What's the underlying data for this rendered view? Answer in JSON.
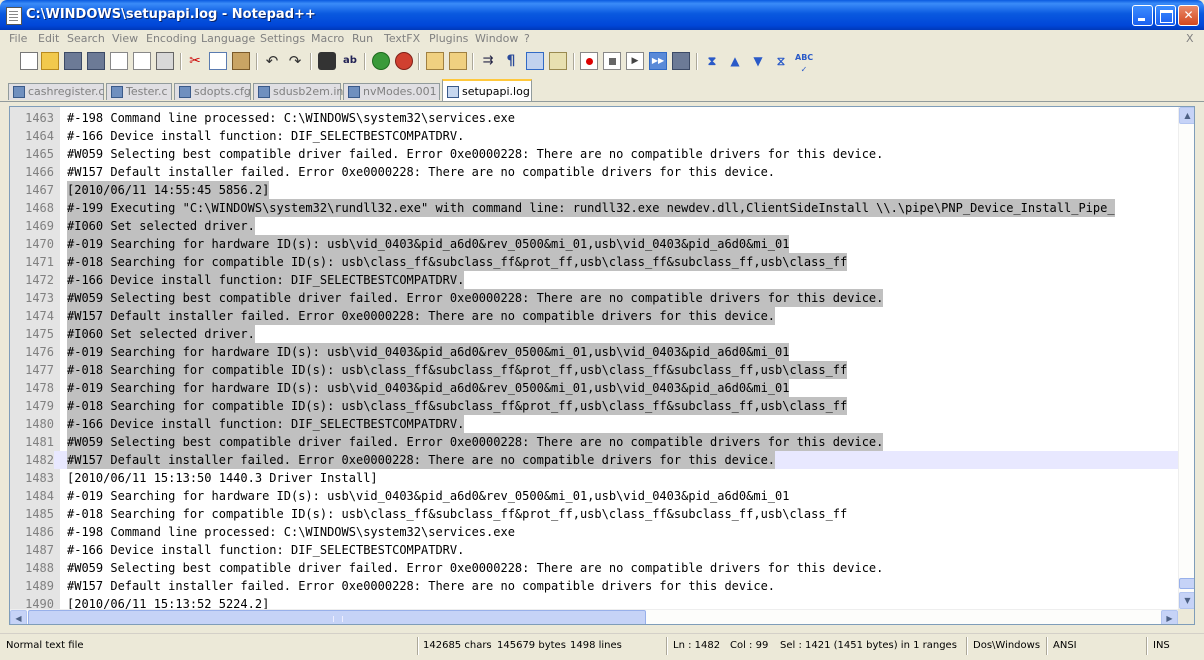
{
  "window": {
    "title": "C:\\WINDOWS\\setupapi.log - Notepad++"
  },
  "menu": [
    "File",
    "Edit",
    "Search",
    "View",
    "Encoding",
    "Language",
    "Settings",
    "Macro",
    "Run",
    "TextFX",
    "Plugins",
    "Window",
    "?"
  ],
  "menu_close": "X",
  "toolbar_icons": [
    "new-file-icon",
    "open-file-icon",
    "save-icon",
    "save-all-icon",
    "close-icon",
    "close-all-icon",
    "print-icon",
    "cut-icon",
    "copy-icon",
    "paste-icon",
    "undo-icon",
    "redo-icon",
    "find-icon",
    "replace-icon",
    "zoom-in-icon",
    "zoom-out-icon",
    "sync-vertical-icon",
    "sync-horizontal-icon",
    "word-wrap-icon",
    "show-all-chars-icon",
    "indent-guide-icon",
    "user-lang-icon",
    "record-macro-icon",
    "stop-record-icon",
    "play-macro-icon",
    "run-macro-multiple-icon",
    "save-macro-icon",
    "textfx-collapse-icon",
    "textfx-up-icon",
    "textfx-down-icon",
    "textfx-trim-icon",
    "spell-check-icon"
  ],
  "tabs": [
    {
      "label": "cashregister.c",
      "active": false
    },
    {
      "label": "Tester.c",
      "active": false
    },
    {
      "label": "sdopts.cfg",
      "active": false
    },
    {
      "label": "sdusb2em.inf",
      "active": false
    },
    {
      "label": "nvModes.001",
      "active": false
    },
    {
      "label": "setupapi.log",
      "active": true
    }
  ],
  "editor": {
    "current_line": 1482,
    "lines": [
      {
        "n": "1463",
        "t": "#-198 Command line processed: C:\\WINDOWS\\system32\\services.exe",
        "sel": false
      },
      {
        "n": "1464",
        "t": "#-166 Device install function: DIF_SELECTBESTCOMPATDRV.",
        "sel": false
      },
      {
        "n": "1465",
        "t": "#W059 Selecting best compatible driver failed. Error 0xe0000228: There are no compatible drivers for this device.",
        "sel": false
      },
      {
        "n": "1466",
        "t": "#W157 Default installer failed. Error 0xe0000228: There are no compatible drivers for this device.",
        "sel": false
      },
      {
        "n": "1467",
        "t": "[2010/06/11 14:55:45 5856.2]",
        "sel": true
      },
      {
        "n": "1468",
        "t": "#-199 Executing \"C:\\WINDOWS\\system32\\rundll32.exe\" with command line: rundll32.exe newdev.dll,ClientSideInstall \\\\.\\pipe\\PNP_Device_Install_Pipe_",
        "sel": true
      },
      {
        "n": "1469",
        "t": "#I060 Set selected driver.",
        "sel": true
      },
      {
        "n": "1470",
        "t": "#-019 Searching for hardware ID(s): usb\\vid_0403&pid_a6d0&rev_0500&mi_01,usb\\vid_0403&pid_a6d0&mi_01",
        "sel": true
      },
      {
        "n": "1471",
        "t": "#-018 Searching for compatible ID(s): usb\\class_ff&subclass_ff&prot_ff,usb\\class_ff&subclass_ff,usb\\class_ff",
        "sel": true
      },
      {
        "n": "1472",
        "t": "#-166 Device install function: DIF_SELECTBESTCOMPATDRV.",
        "sel": true
      },
      {
        "n": "1473",
        "t": "#W059 Selecting best compatible driver failed. Error 0xe0000228: There are no compatible drivers for this device.",
        "sel": true
      },
      {
        "n": "1474",
        "t": "#W157 Default installer failed. Error 0xe0000228: There are no compatible drivers for this device.",
        "sel": true
      },
      {
        "n": "1475",
        "t": "#I060 Set selected driver.",
        "sel": true
      },
      {
        "n": "1476",
        "t": "#-019 Searching for hardware ID(s): usb\\vid_0403&pid_a6d0&rev_0500&mi_01,usb\\vid_0403&pid_a6d0&mi_01",
        "sel": true
      },
      {
        "n": "1477",
        "t": "#-018 Searching for compatible ID(s): usb\\class_ff&subclass_ff&prot_ff,usb\\class_ff&subclass_ff,usb\\class_ff",
        "sel": true
      },
      {
        "n": "1478",
        "t": "#-019 Searching for hardware ID(s): usb\\vid_0403&pid_a6d0&rev_0500&mi_01,usb\\vid_0403&pid_a6d0&mi_01",
        "sel": true
      },
      {
        "n": "1479",
        "t": "#-018 Searching for compatible ID(s): usb\\class_ff&subclass_ff&prot_ff,usb\\class_ff&subclass_ff,usb\\class_ff",
        "sel": true
      },
      {
        "n": "1480",
        "t": "#-166 Device install function: DIF_SELECTBESTCOMPATDRV.",
        "sel": true
      },
      {
        "n": "1481",
        "t": "#W059 Selecting best compatible driver failed. Error 0xe0000228: There are no compatible drivers for this device.",
        "sel": true
      },
      {
        "n": "1482",
        "t": "#W157 Default installer failed. Error 0xe0000228: There are no compatible drivers for this device.",
        "sel": true
      },
      {
        "n": "1483",
        "t": "[2010/06/11 15:13:50 1440.3 Driver Install]",
        "sel": false
      },
      {
        "n": "1484",
        "t": "#-019 Searching for hardware ID(s): usb\\vid_0403&pid_a6d0&rev_0500&mi_01,usb\\vid_0403&pid_a6d0&mi_01",
        "sel": false
      },
      {
        "n": "1485",
        "t": "#-018 Searching for compatible ID(s): usb\\class_ff&subclass_ff&prot_ff,usb\\class_ff&subclass_ff,usb\\class_ff",
        "sel": false
      },
      {
        "n": "1486",
        "t": "#-198 Command line processed: C:\\WINDOWS\\system32\\services.exe",
        "sel": false
      },
      {
        "n": "1487",
        "t": "#-166 Device install function: DIF_SELECTBESTCOMPATDRV.",
        "sel": false
      },
      {
        "n": "1488",
        "t": "#W059 Selecting best compatible driver failed. Error 0xe0000228: There are no compatible drivers for this device.",
        "sel": false
      },
      {
        "n": "1489",
        "t": "#W157 Default installer failed. Error 0xe0000228: There are no compatible drivers for this device.",
        "sel": false
      },
      {
        "n": "1490",
        "t": "[2010/06/11 15:13:52 5224.2]",
        "sel": false
      }
    ]
  },
  "status": {
    "file_type": "Normal text file",
    "chars": "142685 chars",
    "bytes": "145679 bytes",
    "lines": "1498 lines",
    "ln": "Ln : 1482",
    "col": "Col : 99",
    "sel": "Sel : 1421 (1451 bytes) in 1 ranges",
    "eol": "Dos\\Windows",
    "encoding": "ANSI",
    "mode": "INS"
  },
  "colors": {
    "selection": "#c0c0c0",
    "current_line": "#e8e8ff",
    "active_tab_accent": "#ffc83c",
    "title_bar": "#0a5ae0"
  }
}
